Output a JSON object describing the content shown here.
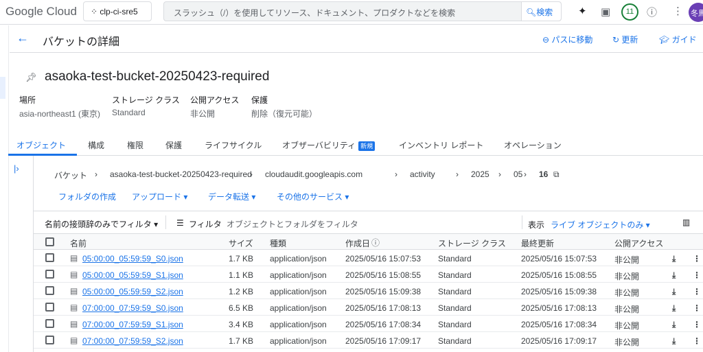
{
  "topbar": {
    "logo": "Google Cloud",
    "project": "clp-ci-sre5",
    "search_placeholder": "スラッシュ（/）を使用してリソース、ドキュメント、プロダクトなどを検索",
    "search_button": "検索",
    "notifications": "11",
    "avatar": "冬馬"
  },
  "header": {
    "title": "バケットの詳細",
    "go_to_path": "パスに移動",
    "refresh": "更新",
    "guide": "ガイド"
  },
  "bucket": {
    "name": "asaoka-test-bucket-20250423-required",
    "props": [
      {
        "label": "場所",
        "value": "asia-northeast1 (東京)"
      },
      {
        "label": "ストレージ クラス",
        "value": "Standard"
      },
      {
        "label": "公開アクセス",
        "value": "非公開"
      },
      {
        "label": "保護",
        "value": "削除（復元可能）"
      }
    ]
  },
  "tabs": [
    {
      "label": "オブジェクト",
      "active": true
    },
    {
      "label": "構成"
    },
    {
      "label": "権限"
    },
    {
      "label": "保護"
    },
    {
      "label": "ライフサイクル"
    },
    {
      "label": "オブザーバビリティ",
      "badge": "新規"
    },
    {
      "label": "インベントリ レポート"
    },
    {
      "label": "オペレーション"
    }
  ],
  "breadcrumb": [
    "バケット",
    "asaoka-test-bucket-20250423-required",
    "cloudaudit.googleapis.com",
    "activity",
    "2025",
    "05",
    "16"
  ],
  "actions": {
    "create_folder": "フォルダの作成",
    "upload": "アップロード",
    "transfer": "データ転送",
    "other": "その他のサービス"
  },
  "filter": {
    "prefix": "名前の接頭辞のみでフィルタ",
    "filter_label": "フィルタ",
    "placeholder": "オブジェクトとフォルダをフィルタ",
    "view_label": "表示",
    "view_value": "ライブ オブジェクトのみ"
  },
  "table": {
    "columns": [
      "名前",
      "サイズ",
      "種類",
      "作成日",
      "ストレージ クラス",
      "最終更新",
      "公開アクセス"
    ],
    "rows": [
      [
        "05:00:00_05:59:59_S0.json",
        "1.7 KB",
        "application/json",
        "2025/05/16 15:07:53",
        "Standard",
        "2025/05/16 15:07:53",
        "非公開"
      ],
      [
        "05:00:00_05:59:59_S1.json",
        "1.1 KB",
        "application/json",
        "2025/05/16 15:08:55",
        "Standard",
        "2025/05/16 15:08:55",
        "非公開"
      ],
      [
        "05:00:00_05:59:59_S2.json",
        "1.2 KB",
        "application/json",
        "2025/05/16 15:09:38",
        "Standard",
        "2025/05/16 15:09:38",
        "非公開"
      ],
      [
        "07:00:00_07:59:59_S0.json",
        "6.5 KB",
        "application/json",
        "2025/05/16 17:08:13",
        "Standard",
        "2025/05/16 17:08:13",
        "非公開"
      ],
      [
        "07:00:00_07:59:59_S1.json",
        "3.4 KB",
        "application/json",
        "2025/05/16 17:08:34",
        "Standard",
        "2025/05/16 17:08:34",
        "非公開"
      ],
      [
        "07:00:00_07:59:59_S2.json",
        "1.7 KB",
        "application/json",
        "2025/05/16 17:09:17",
        "Standard",
        "2025/05/16 17:09:17",
        "非公開"
      ]
    ]
  }
}
